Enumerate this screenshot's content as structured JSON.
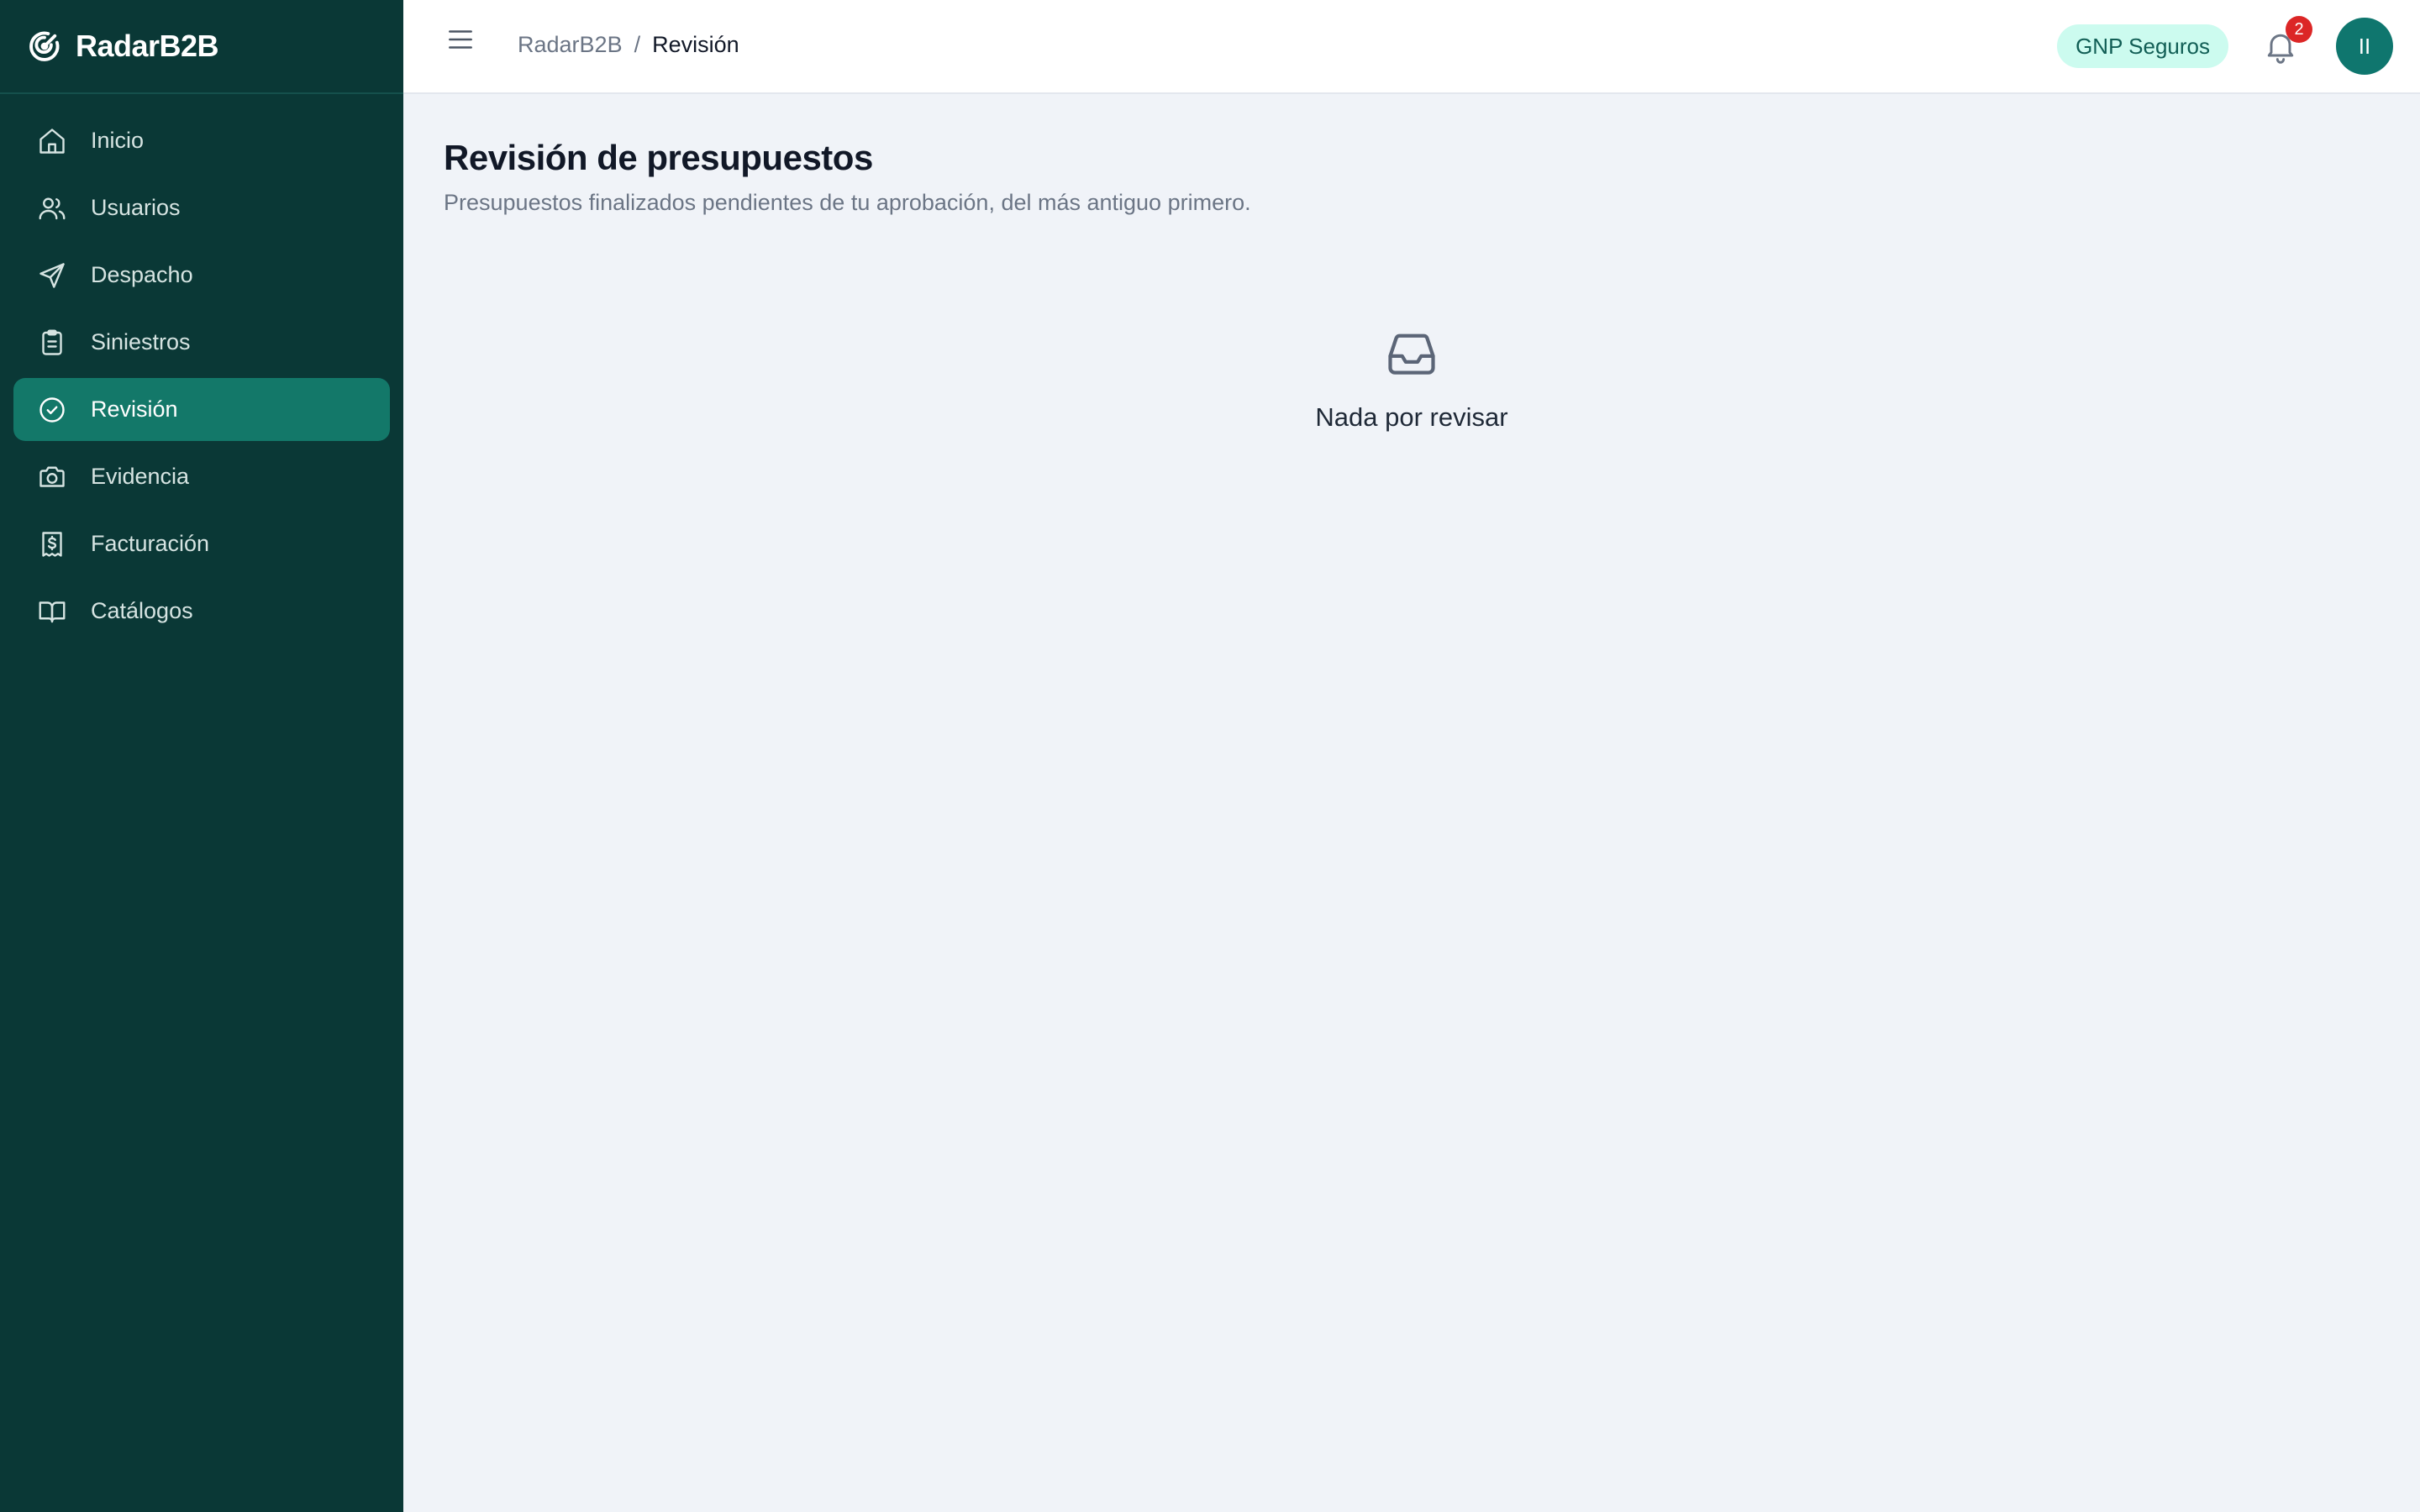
{
  "brand": {
    "name": "RadarB2B",
    "icon": "radar-icon"
  },
  "sidebar": {
    "items": [
      {
        "label": "Inicio",
        "icon": "home-icon",
        "active": false
      },
      {
        "label": "Usuarios",
        "icon": "users-icon",
        "active": false
      },
      {
        "label": "Despacho",
        "icon": "send-icon",
        "active": false
      },
      {
        "label": "Siniestros",
        "icon": "clipboard-icon",
        "active": false
      },
      {
        "label": "Revisión",
        "icon": "check-circle-icon",
        "active": true
      },
      {
        "label": "Evidencia",
        "icon": "camera-icon",
        "active": false
      },
      {
        "label": "Facturación",
        "icon": "receipt-icon",
        "active": false
      },
      {
        "label": "Catálogos",
        "icon": "book-open-icon",
        "active": false
      }
    ]
  },
  "header": {
    "breadcrumb": {
      "root": "RadarB2B",
      "separator": "/",
      "current": "Revisión"
    },
    "org_badge": "GNP Seguros",
    "notifications_count": "2",
    "avatar_initials": "II"
  },
  "main": {
    "title": "Revisión de presupuestos",
    "subtitle": "Presupuestos finalizados pendientes de tu aprobación, del más antiguo primero.",
    "empty_state": {
      "icon": "inbox-icon",
      "text": "Nada por revisar"
    }
  },
  "colors": {
    "sidebar_bg": "#0a3836",
    "active_item": "#137869",
    "accent": "#0f766e",
    "badge_bg": "#ccfbef",
    "notification": "#dc2626",
    "page_bg": "#f0f3f8"
  }
}
